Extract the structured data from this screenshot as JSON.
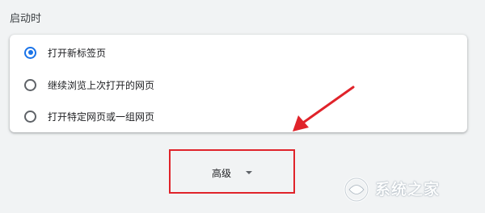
{
  "section": {
    "title": "启动时"
  },
  "startup_options": [
    {
      "label": "打开新标签页",
      "selected": true
    },
    {
      "label": "继续浏览上次打开的网页",
      "selected": false
    },
    {
      "label": "打开特定网页或一组网页",
      "selected": false
    }
  ],
  "advanced": {
    "label": "高级",
    "caret_icon": "caret-down-icon"
  },
  "annotation": {
    "highlight_color": "#e0232a",
    "arrow_color": "#e0232a"
  },
  "watermark": {
    "text": "系统之家"
  },
  "colors": {
    "accent": "#1a73e8",
    "background": "#f1f3f4",
    "card": "#ffffff"
  }
}
